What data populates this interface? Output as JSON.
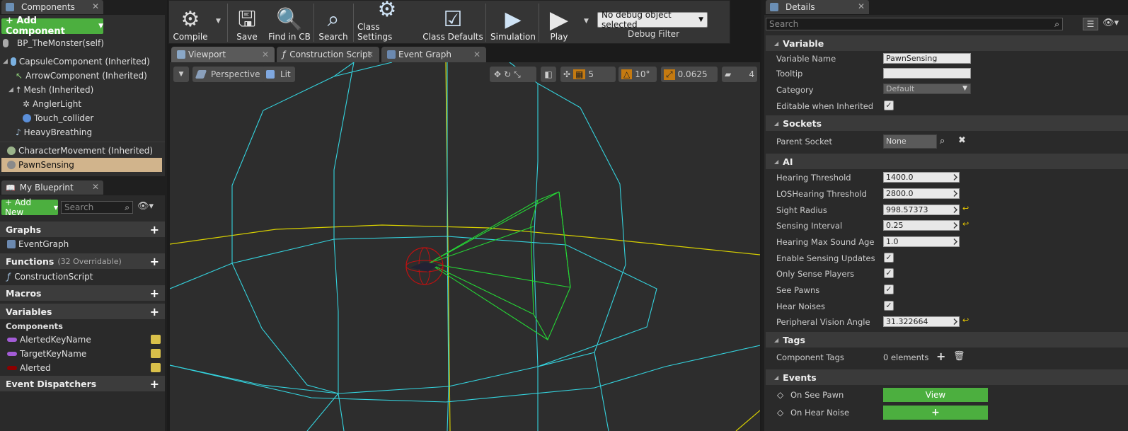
{
  "components_panel": {
    "tab_label": "Components",
    "add_component_label": "+ Add Component",
    "items": [
      {
        "label": "BP_TheMonster(self)"
      },
      {
        "label": "CapsuleComponent (Inherited)"
      },
      {
        "label": "ArrowComponent (Inherited)"
      },
      {
        "label": "Mesh (Inherited)"
      },
      {
        "label": "AnglerLight"
      },
      {
        "label": "Touch_collider"
      },
      {
        "label": "HeavyBreathing"
      },
      {
        "label": "CharacterMovement (Inherited)"
      },
      {
        "label": "PawnSensing",
        "selected": true
      }
    ]
  },
  "my_blueprint": {
    "tab_label": "My Blueprint",
    "add_new_label": "+ Add New",
    "search_placeholder": "Search",
    "graphs_label": "Graphs",
    "event_graph_label": "EventGraph",
    "functions_label": "Functions",
    "functions_count": "(32 Overridable)",
    "construction_script_label": "ConstructionScript",
    "macros_label": "Macros",
    "variables_label": "Variables",
    "components_label": "Components",
    "variables": [
      {
        "label": "AlertedKeyName",
        "color": "#a35cd6"
      },
      {
        "label": "TargetKeyName",
        "color": "#a35cd6"
      },
      {
        "label": "Alerted",
        "color": "#8c0000"
      }
    ],
    "event_dispatchers_label": "Event Dispatchers"
  },
  "toolbar": {
    "compile_label": "Compile",
    "save_label": "Save",
    "find_in_cb_label": "Find in CB",
    "search_label": "Search",
    "class_settings_label": "Class Settings",
    "class_defaults_label": "Class Defaults",
    "simulation_label": "Simulation",
    "play_label": "Play",
    "debug_select_value": "No debug object selected",
    "debug_filter_label": "Debug Filter"
  },
  "editor_tabs": [
    {
      "label": "Viewport"
    },
    {
      "label": "Construction Script"
    },
    {
      "label": "Event Graph"
    }
  ],
  "viewport": {
    "perspective_label": "Perspective",
    "lit_label": "Lit",
    "grid_value": "5",
    "angle_value": "10°",
    "scale_value": "0.0625",
    "camera_speed_value": "4"
  },
  "details": {
    "tab_label": "Details",
    "search_placeholder": "Search",
    "variable_section": "Variable",
    "variable_name_label": "Variable Name",
    "variable_name_value": "PawnSensing",
    "tooltip_label": "Tooltip",
    "tooltip_value": "",
    "category_label": "Category",
    "category_value": "Default",
    "editable_inherited_label": "Editable when Inherited",
    "sockets_section": "Sockets",
    "parent_socket_label": "Parent Socket",
    "parent_socket_value": "None",
    "ai_section": "AI",
    "ai_props": [
      {
        "label": "Hearing Threshold",
        "value": "1400.0"
      },
      {
        "label": "LOSHearing Threshold",
        "value": "2800.0"
      },
      {
        "label": "Sight Radius",
        "value": "998.57373"
      },
      {
        "label": "Sensing Interval",
        "value": "0.25"
      },
      {
        "label": "Hearing Max Sound Age",
        "value": "1.0"
      }
    ],
    "ai_checks": [
      {
        "label": "Enable Sensing Updates"
      },
      {
        "label": "Only Sense Players"
      },
      {
        "label": "See Pawns"
      },
      {
        "label": "Hear Noises"
      }
    ],
    "peripheral_label": "Peripheral Vision Angle",
    "peripheral_value": "31.322664",
    "tags_section": "Tags",
    "component_tags_label": "Component Tags",
    "component_tags_value": "0 elements",
    "events_section": "Events",
    "on_see_pawn_label": "On See Pawn",
    "on_see_pawn_button": "View",
    "on_hear_noise_label": "On Hear Noise",
    "on_hear_noise_button": "+"
  }
}
